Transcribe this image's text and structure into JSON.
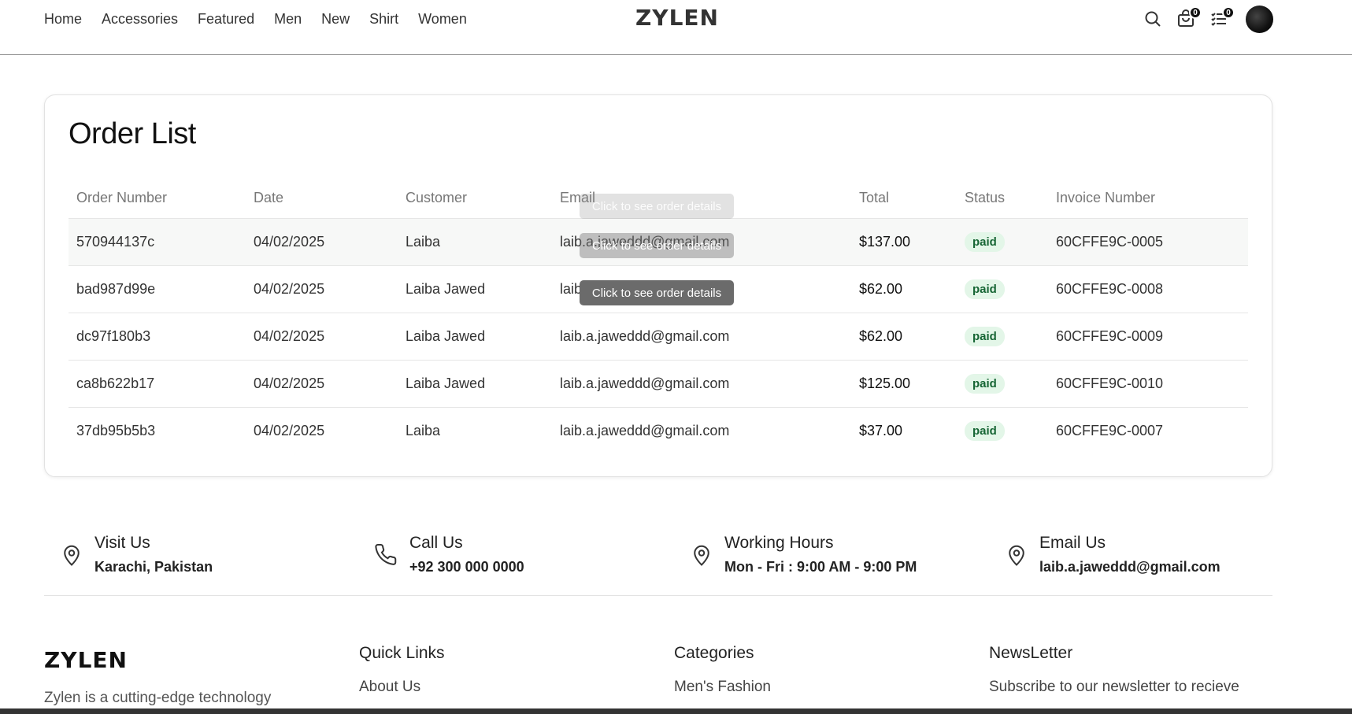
{
  "header": {
    "nav": [
      "Home",
      "Accessories",
      "Featured",
      "Men",
      "New",
      "Shirt",
      "Women"
    ],
    "logo": "ZYLEN",
    "cart_count": "0",
    "orders_count": "0"
  },
  "orders": {
    "title": "Order List",
    "columns": [
      "Order Number",
      "Date",
      "Customer",
      "Email",
      "Total",
      "Status",
      "Invoice Number"
    ],
    "rows": [
      {
        "order": "570944137c",
        "date": "04/02/2025",
        "customer": "Laiba",
        "email": "laib.a.jaweddd@gmail.com",
        "total": "$137.00",
        "status": "paid",
        "invoice": "60CFFE9C-0005"
      },
      {
        "order": "bad987d99e",
        "date": "04/02/2025",
        "customer": "Laiba Jawed",
        "email": "laib.a.jaweddd@gmail.com",
        "total": "$62.00",
        "status": "paid",
        "invoice": "60CFFE9C-0008"
      },
      {
        "order": "dc97f180b3",
        "date": "04/02/2025",
        "customer": "Laiba Jawed",
        "email": "laib.a.jaweddd@gmail.com",
        "total": "$62.00",
        "status": "paid",
        "invoice": "60CFFE9C-0009"
      },
      {
        "order": "ca8b622b17",
        "date": "04/02/2025",
        "customer": "Laiba Jawed",
        "email": "laib.a.jaweddd@gmail.com",
        "total": "$125.00",
        "status": "paid",
        "invoice": "60CFFE9C-0010"
      },
      {
        "order": "37db95b5b3",
        "date": "04/02/2025",
        "customer": "Laiba",
        "email": "laib.a.jaweddd@gmail.com",
        "total": "$37.00",
        "status": "paid",
        "invoice": "60CFFE9C-0007"
      }
    ],
    "tooltip": "Click to see order details"
  },
  "contact": [
    {
      "title": "Visit Us",
      "value": "Karachi, Pakistan",
      "icon": "map-pin-icon"
    },
    {
      "title": "Call Us",
      "value": "+92 300 000 0000",
      "icon": "phone-icon"
    },
    {
      "title": "Working Hours",
      "value": "Mon - Fri : 9:00 AM - 9:00 PM",
      "icon": "map-pin-icon"
    },
    {
      "title": "Email Us",
      "value": "laib.a.jaweddd@gmail.com",
      "icon": "map-pin-icon"
    }
  ],
  "footer": {
    "logo": "ZYLEN",
    "description": "Zylen is a cutting-edge technology",
    "quick_links_title": "Quick Links",
    "quick_link_1": "About Us",
    "categories_title": "Categories",
    "category_1": "Men's Fashion",
    "newsletter_title": "NewsLetter",
    "newsletter_text": "Subscribe to our newsletter to recieve"
  },
  "colors": {
    "paid_bg": "#e3f6e8",
    "paid_text": "#166534",
    "tooltip": "#6b6b6b"
  }
}
